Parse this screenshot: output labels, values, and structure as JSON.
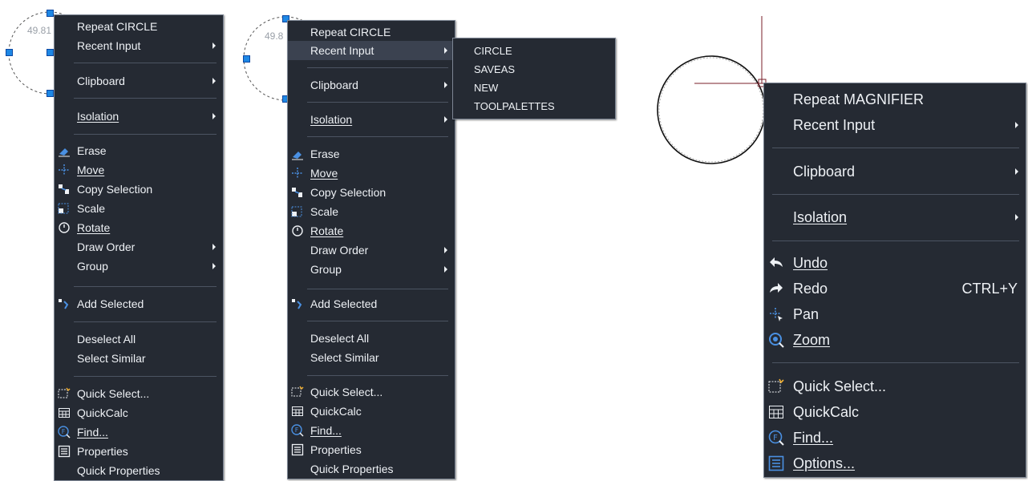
{
  "colors": {
    "menu_bg": "#252a33",
    "menu_text": "#eef1f5",
    "separator": "#4c5462",
    "icon_blue": "#1e88e5",
    "grip": "#1e88e5"
  },
  "canvas": {
    "dimension_label": "49.81",
    "dimension_label_2": "49.8"
  },
  "menu1": {
    "repeat_circle": "Repeat CIRCLE",
    "recent_input": "Recent Input",
    "clipboard": "Clipboard",
    "isolation": "Isolation",
    "erase": "Erase",
    "move": "Move",
    "copy_selection": "Copy Selection",
    "scale": "Scale",
    "rotate": "Rotate",
    "draw_order": "Draw Order",
    "group": "Group",
    "add_selected": "Add Selected",
    "deselect_all": "Deselect All",
    "select_similar": "Select Similar",
    "quick_select": "Quick Select...",
    "quickcalc": "QuickCalc",
    "find": "Find...",
    "properties": "Properties",
    "quick_properties": "Quick Properties"
  },
  "menu2": {
    "repeat_circle": "Repeat CIRCLE",
    "recent_input": "Recent Input",
    "clipboard": "Clipboard",
    "isolation": "Isolation",
    "erase": "Erase",
    "move": "Move",
    "copy_selection": "Copy Selection",
    "scale": "Scale",
    "rotate": "Rotate",
    "draw_order": "Draw Order",
    "group": "Group",
    "add_selected": "Add Selected",
    "deselect_all": "Deselect All",
    "select_similar": "Select Similar",
    "quick_select": "Quick Select...",
    "quickcalc": "QuickCalc",
    "find": "Find...",
    "properties": "Properties",
    "quick_properties": "Quick Properties"
  },
  "recent_input_submenu": {
    "items": [
      "CIRCLE",
      "SAVEAS",
      "NEW",
      "TOOLPALETTES"
    ]
  },
  "menu3": {
    "repeat_magnifier": "Repeat MAGNIFIER",
    "recent_input": "Recent Input",
    "clipboard": "Clipboard",
    "isolation": "Isolation",
    "undo": "Undo",
    "redo": "Redo",
    "redo_shortcut": "CTRL+Y",
    "pan": "Pan",
    "zoom": "Zoom",
    "quick_select": "Quick Select...",
    "quickcalc": "QuickCalc",
    "find": "Find...",
    "options": "Options..."
  }
}
